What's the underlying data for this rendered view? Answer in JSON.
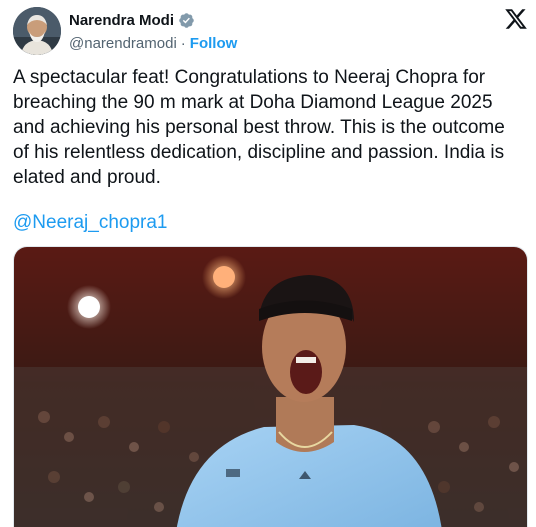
{
  "author": {
    "name": "Narendra Modi",
    "handle": "@narendramodi",
    "separator": "·",
    "follow_label": "Follow"
  },
  "tweet": {
    "text": "A spectacular feat! Congratulations to Neeraj Chopra for\nbreaching the 90 m mark at Doha Diamond League 2025\nand achieving his personal best throw. This is the outcome\nof his relentless dedication, discipline and passion. India is\nelated and proud.",
    "mention": "@Neeraj_chopra1"
  },
  "icons": {
    "verified": "verified-badge-icon",
    "platform": "x-logo-icon"
  },
  "colors": {
    "accent": "#1d9bf0",
    "text": "#0f1419",
    "secondary": "#536471",
    "shirt": "#8fc3ea"
  }
}
